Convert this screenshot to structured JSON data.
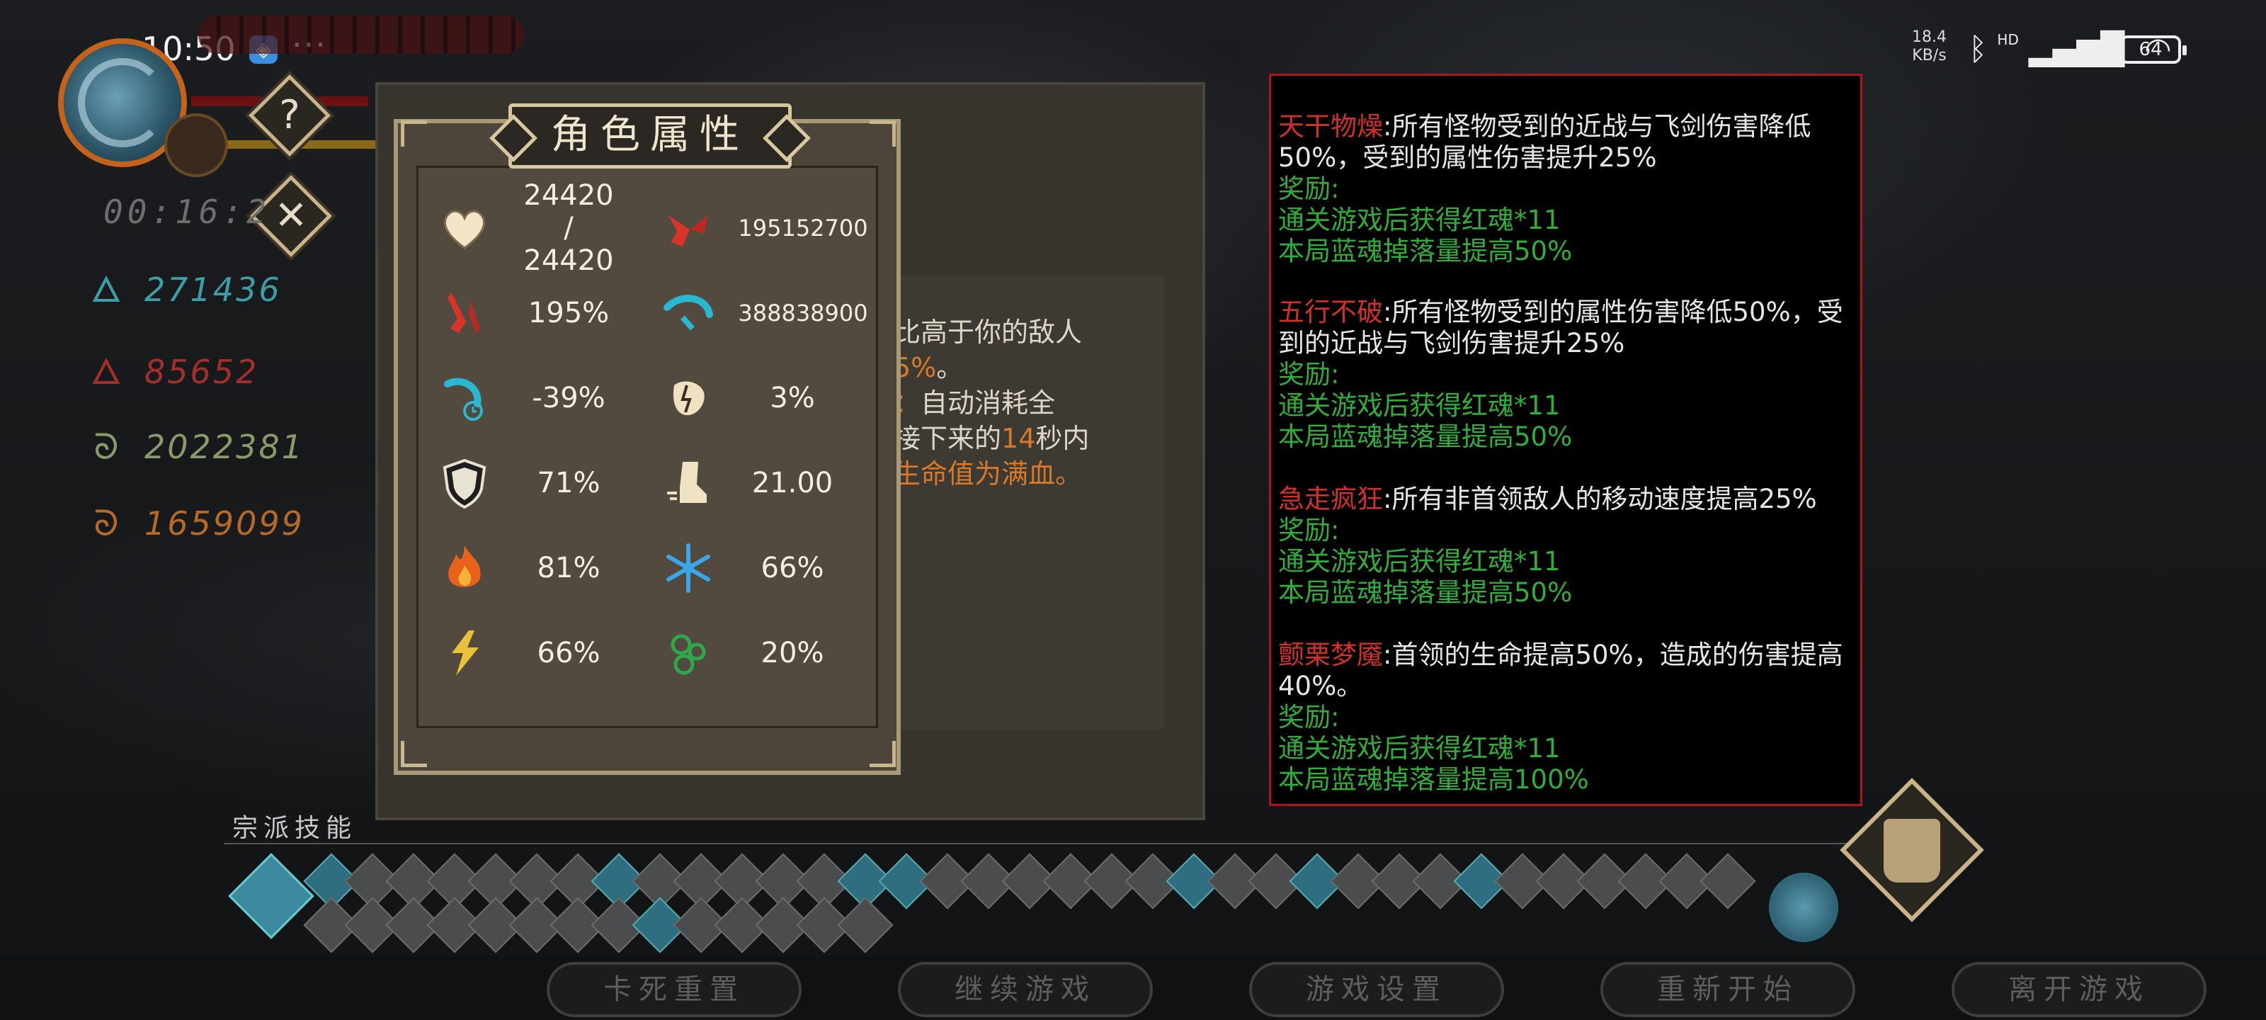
{
  "status_bar": {
    "time": "10:50",
    "net_speed_value": "18.4",
    "net_speed_unit": "KB/s",
    "hd_label": "HD",
    "battery": "64"
  },
  "hud": {
    "help_glyph": "?",
    "close_glyph": "✕",
    "timer": "00:16:2",
    "resources": [
      {
        "icon": "blue-soul-icon",
        "value": "271436",
        "color": "#3c9ea6"
      },
      {
        "icon": "red-soul-icon",
        "value": "85652",
        "color": "#a2302a"
      },
      {
        "icon": "green-spirit-icon",
        "value": "2022381",
        "color": "#8a9a6a"
      },
      {
        "icon": "orange-spirit-icon",
        "value": "1659099",
        "color": "#b66a2a"
      }
    ]
  },
  "attribute_panel": {
    "title": "角色属性",
    "stats": [
      {
        "icon": "heart-icon",
        "value": "24420 / 24420"
      },
      {
        "icon": "attack-damage-icon",
        "value": "195152700"
      },
      {
        "icon": "crit-rate-icon",
        "value": "195%"
      },
      {
        "icon": "crit-damage-icon",
        "value": "388838900"
      },
      {
        "icon": "cooldown-icon",
        "value": "-39%"
      },
      {
        "icon": "lifesteal-icon",
        "value": "3%"
      },
      {
        "icon": "shield-icon",
        "value": "71%"
      },
      {
        "icon": "boot-speed-icon",
        "value": "21.00"
      },
      {
        "icon": "fire-icon",
        "value": "81%"
      },
      {
        "icon": "ice-snowflake-icon",
        "value": "66%"
      },
      {
        "icon": "lightning-icon",
        "value": "66%"
      },
      {
        "icon": "poison-icon",
        "value": "20%"
      }
    ]
  },
  "book": {
    "line1": "比高于你的敌人",
    "line2_prefix": "5%",
    "line2_suffix": "。",
    "line3_prefix": "：",
    "line3_text": "自动消耗全",
    "line4_prefix": "接下来的",
    "line4_num": "14",
    "line4_suffix": "秒内",
    "line5": "生命值为满血。"
  },
  "rules": [
    {
      "name": "天干物燥",
      "desc": ":所有怪物受到的近战与飞剑伤害降低50%，受到的属性伤害提升25%",
      "reward_label": "奖励:",
      "rewards": [
        "通关游戏后获得红魂*11",
        "本局蓝魂掉落量提高50%"
      ]
    },
    {
      "name": "五行不破",
      "desc": ":所有怪物受到的属性伤害降低50%，受到的近战与飞剑伤害提升25%",
      "reward_label": "奖励:",
      "rewards": [
        "通关游戏后获得红魂*11",
        "本局蓝魂掉落量提高50%"
      ]
    },
    {
      "name": "急走疯狂",
      "desc": ":所有非首领敌人的移动速度提高25%",
      "reward_label": "奖励:",
      "rewards": [
        "通关游戏后获得红魂*11",
        "本局蓝魂掉落量提高50%"
      ]
    },
    {
      "name": "颤栗梦魇",
      "desc": ":首领的生命提高50%，造成的伤害提高40%。",
      "reward_label": "奖励:",
      "rewards": [
        "通关游戏后获得红魂*11",
        "本局蓝魂掉落量提高100%"
      ]
    }
  ],
  "skills": {
    "label": "宗派技能"
  },
  "menu": {
    "buttons": [
      "卡死重置",
      "继续游戏",
      "游戏设置",
      "重新开始",
      "离开游戏"
    ]
  },
  "colors": {
    "accent_gold": "#c9b48a",
    "rule_red": "#d2302a",
    "reward_green": "#2fae3a",
    "book_orange": "#d8792a"
  }
}
